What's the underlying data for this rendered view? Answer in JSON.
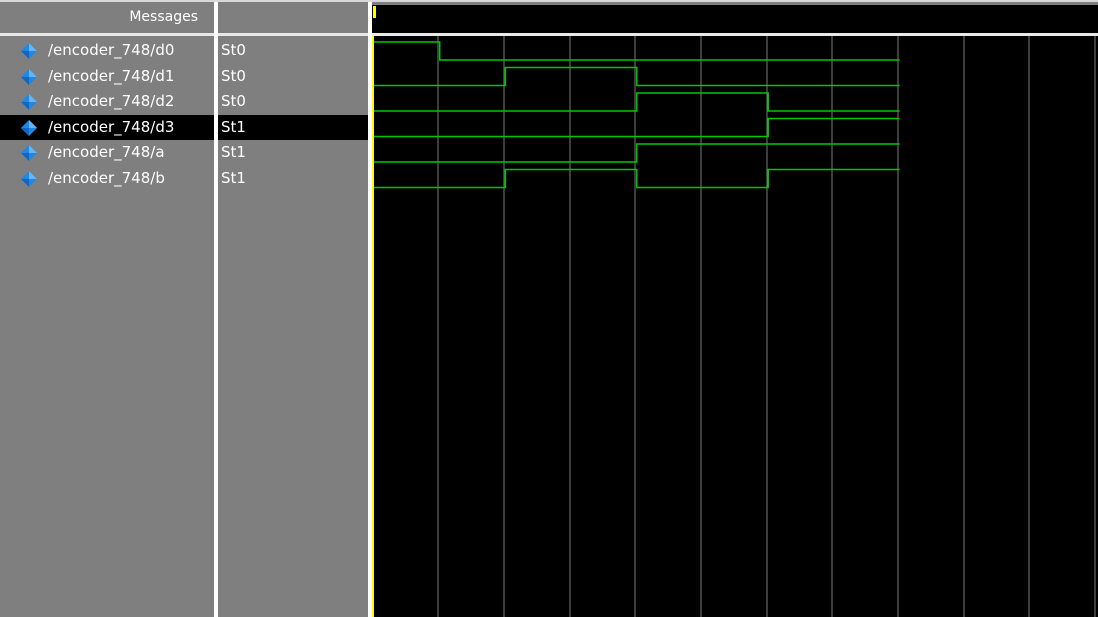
{
  "header": {
    "messages_label": "Messages"
  },
  "signals": [
    {
      "name": "/encoder_748/d0",
      "value": "St0",
      "selected": false,
      "icon": "diamond-icon",
      "levels": [
        1,
        0,
        0,
        0,
        0,
        0,
        0,
        0
      ]
    },
    {
      "name": "/encoder_748/d1",
      "value": "St0",
      "selected": false,
      "icon": "diamond-icon",
      "levels": [
        0,
        0,
        1,
        1,
        0,
        0,
        0,
        0
      ]
    },
    {
      "name": "/encoder_748/d2",
      "value": "St0",
      "selected": false,
      "icon": "diamond-icon",
      "levels": [
        0,
        0,
        0,
        0,
        1,
        1,
        0,
        0
      ]
    },
    {
      "name": "/encoder_748/d3",
      "value": "St1",
      "selected": true,
      "icon": "diamond-icon",
      "levels": [
        0,
        0,
        0,
        0,
        0,
        0,
        1,
        1
      ]
    },
    {
      "name": "/encoder_748/a",
      "value": "St1",
      "selected": false,
      "icon": "diamond-icon",
      "levels": [
        0,
        0,
        0,
        0,
        1,
        1,
        1,
        1
      ]
    },
    {
      "name": "/encoder_748/b",
      "value": "St1",
      "selected": false,
      "icon": "diamond-icon",
      "levels": [
        0,
        0,
        1,
        1,
        0,
        0,
        1,
        1
      ]
    }
  ],
  "wave_colors": {
    "trace": "#00c800",
    "grid": "#7a7a7a",
    "cursor": "#ffff00",
    "selected_bg": "#000000",
    "panel_bg": "#7f7f7f"
  }
}
